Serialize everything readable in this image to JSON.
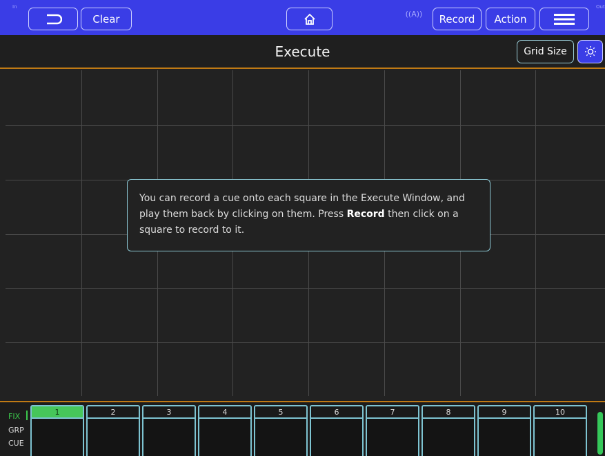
{
  "topbar": {
    "corner_left": "In",
    "corner_right": "Out",
    "clear_label": "Clear",
    "record_label": "Record",
    "action_label": "Action",
    "wifi_label": "((A))"
  },
  "header": {
    "title": "Execute",
    "grid_size_label": "Grid Size"
  },
  "tip": {
    "line_a": "You can record a cue onto each square in the Execute Window, and play them back by clicking on them. Press ",
    "bold": "Record",
    "line_b": " then click on a square to record to it."
  },
  "bottom": {
    "modes": [
      "FIX",
      "GRP",
      "CUE"
    ],
    "slots": [
      "1",
      "2",
      "3",
      "4",
      "5",
      "6",
      "7",
      "8",
      "9",
      "10"
    ],
    "active_slot": "1"
  },
  "colors": {
    "topbar": "#3a3de6",
    "accent_line": "#c07a14",
    "active_slot": "#46c65a",
    "border": "#7ec4d2"
  }
}
